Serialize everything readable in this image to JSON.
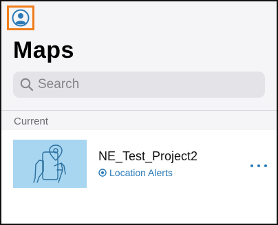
{
  "header": {
    "profile_icon": "user-circle-icon",
    "title": "Maps"
  },
  "search": {
    "icon": "search-icon",
    "placeholder": "Search"
  },
  "section": {
    "label": "Current"
  },
  "maps": [
    {
      "thumbnail": "location-alerts-illustration",
      "name": "NE_Test_Project2",
      "badge_icon": "location-target-icon",
      "badge_label": "Location Alerts",
      "more_icon": "more-horizontal-icon"
    }
  ],
  "colors": {
    "accent": "#2a7ab8",
    "highlight_border": "#f07d1a",
    "thumbnail_bg": "#a8d6f1",
    "header_bg": "#f5f5f7"
  }
}
